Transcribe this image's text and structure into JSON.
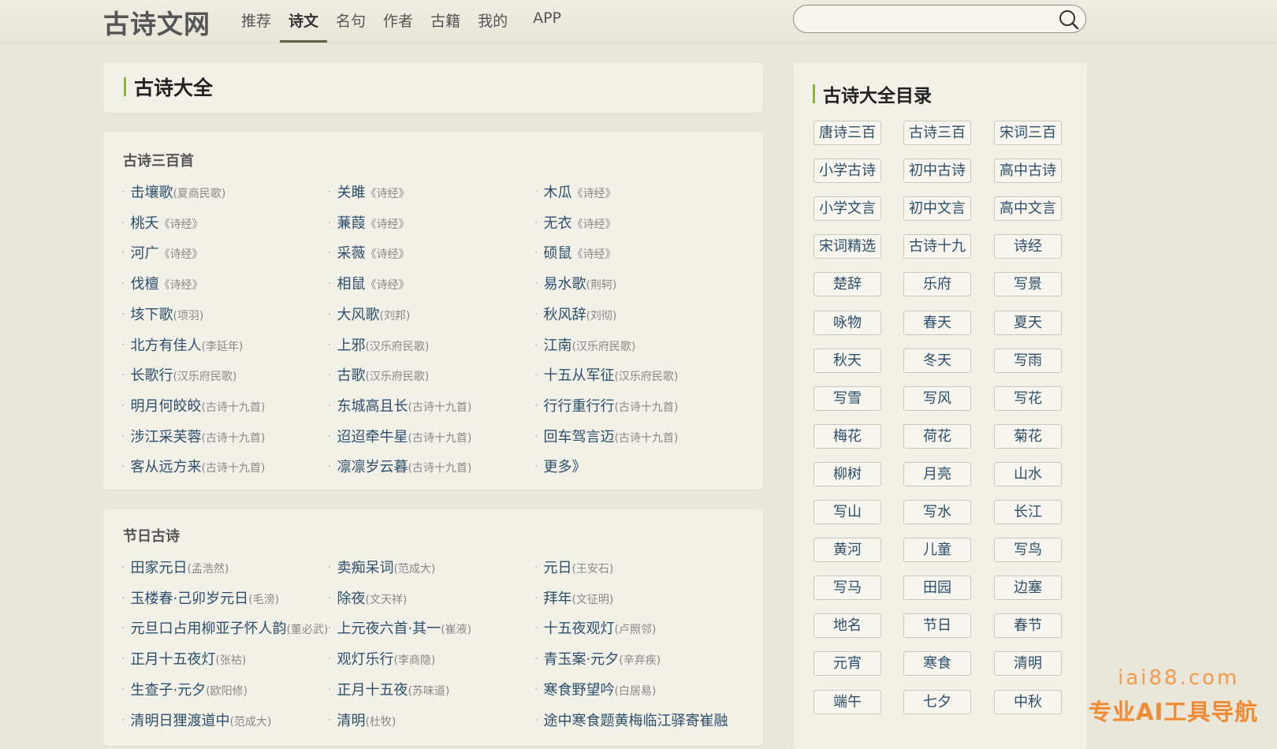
{
  "header": {
    "logo": "古诗文网",
    "nav": [
      {
        "label": "推荐"
      },
      {
        "label": "诗文",
        "active": true
      },
      {
        "label": "名句"
      },
      {
        "label": "作者"
      },
      {
        "label": "古籍"
      },
      {
        "label": "我的"
      },
      {
        "label": "APP"
      }
    ],
    "search": {
      "value": "",
      "placeholder": "",
      "icon": "search-icon"
    }
  },
  "main": {
    "title": "古诗大全",
    "sections": [
      {
        "title": "古诗三百首",
        "items": [
          {
            "title": "击壤歌",
            "author": "(夏商民歌)"
          },
          {
            "title": "关雎",
            "author": "《诗经》"
          },
          {
            "title": "木瓜",
            "author": "《诗经》"
          },
          {
            "title": "桃夭",
            "author": "《诗经》"
          },
          {
            "title": "蒹葭",
            "author": "《诗经》"
          },
          {
            "title": "无衣",
            "author": "《诗经》"
          },
          {
            "title": "河广",
            "author": "《诗经》"
          },
          {
            "title": "采薇",
            "author": "《诗经》"
          },
          {
            "title": "硕鼠",
            "author": "《诗经》"
          },
          {
            "title": "伐檀",
            "author": "《诗经》"
          },
          {
            "title": "相鼠",
            "author": "《诗经》"
          },
          {
            "title": "易水歌",
            "author": "(荆轲)"
          },
          {
            "title": "垓下歌",
            "author": "(项羽)"
          },
          {
            "title": "大风歌",
            "author": "(刘邦)"
          },
          {
            "title": "秋风辞",
            "author": "(刘彻)"
          },
          {
            "title": "北方有佳人",
            "author": "(李延年)"
          },
          {
            "title": "上邪",
            "author": "(汉乐府民歌)"
          },
          {
            "title": "江南",
            "author": "(汉乐府民歌)"
          },
          {
            "title": "长歌行",
            "author": "(汉乐府民歌)"
          },
          {
            "title": "古歌",
            "author": "(汉乐府民歌)"
          },
          {
            "title": "十五从军征",
            "author": "(汉乐府民歌)"
          },
          {
            "title": "明月何皎皎",
            "author": "(古诗十九首)"
          },
          {
            "title": "东城高且长",
            "author": "(古诗十九首)"
          },
          {
            "title": "行行重行行",
            "author": "(古诗十九首)"
          },
          {
            "title": "涉江采芙蓉",
            "author": "(古诗十九首)"
          },
          {
            "title": "迢迢牵牛星",
            "author": "(古诗十九首)"
          },
          {
            "title": "回车驾言迈",
            "author": "(古诗十九首)"
          },
          {
            "title": "客从远方来",
            "author": "(古诗十九首)"
          },
          {
            "title": "凛凛岁云暮",
            "author": "(古诗十九首)"
          },
          {
            "title": "更多》",
            "author": ""
          }
        ]
      },
      {
        "title": "节日古诗",
        "items": [
          {
            "title": "田家元日",
            "author": "(孟浩然)"
          },
          {
            "title": "卖痴呆词",
            "author": "(范成大)"
          },
          {
            "title": "元日",
            "author": "(王安石)"
          },
          {
            "title": "玉楼春·己卯岁元日",
            "author": "(毛滂)"
          },
          {
            "title": "除夜",
            "author": "(文天祥)"
          },
          {
            "title": "拜年",
            "author": "(文征明)"
          },
          {
            "title": "元旦口占用柳亚子怀人韵",
            "author": "(董必武)"
          },
          {
            "title": "上元夜六首·其一",
            "author": "(崔液)"
          },
          {
            "title": "十五夜观灯",
            "author": "(卢照邻)"
          },
          {
            "title": "正月十五夜灯",
            "author": "(张祜)"
          },
          {
            "title": "观灯乐行",
            "author": "(李商隐)"
          },
          {
            "title": "青玉案·元夕",
            "author": "(辛弃疾)"
          },
          {
            "title": "生查子·元夕",
            "author": "(欧阳修)"
          },
          {
            "title": "正月十五夜",
            "author": "(苏味道)"
          },
          {
            "title": "寒食野望吟",
            "author": "(白居易)"
          },
          {
            "title": "清明日狸渡道中",
            "author": "(范成大)"
          },
          {
            "title": "清明",
            "author": "(杜牧)"
          },
          {
            "title": "途中寒食题黄梅临江驿寄崔融",
            "author": ""
          }
        ]
      }
    ]
  },
  "sidebar": {
    "title": "古诗大全目录",
    "tags": [
      "唐诗三百",
      "古诗三百",
      "宋词三百",
      "小学古诗",
      "初中古诗",
      "高中古诗",
      "小学文言",
      "初中文言",
      "高中文言",
      "宋词精选",
      "古诗十九",
      "诗经",
      "楚辞",
      "乐府",
      "写景",
      "咏物",
      "春天",
      "夏天",
      "秋天",
      "冬天",
      "写雨",
      "写雪",
      "写风",
      "写花",
      "梅花",
      "荷花",
      "菊花",
      "柳树",
      "月亮",
      "山水",
      "写山",
      "写水",
      "长江",
      "黄河",
      "儿童",
      "写鸟",
      "写马",
      "田园",
      "边塞",
      "地名",
      "节日",
      "春节",
      "元宵",
      "寒食",
      "清明",
      "端午",
      "七夕",
      "中秋"
    ]
  },
  "watermark": {
    "line1": "iai88.com",
    "line2": "专业AI工具导航"
  },
  "colors": {
    "accent": "#8ab33e",
    "link": "#2d4e6a",
    "page_bg": "#e9e7d9",
    "card_bg": "#f2f1e8",
    "watermark": "#f08a35"
  }
}
